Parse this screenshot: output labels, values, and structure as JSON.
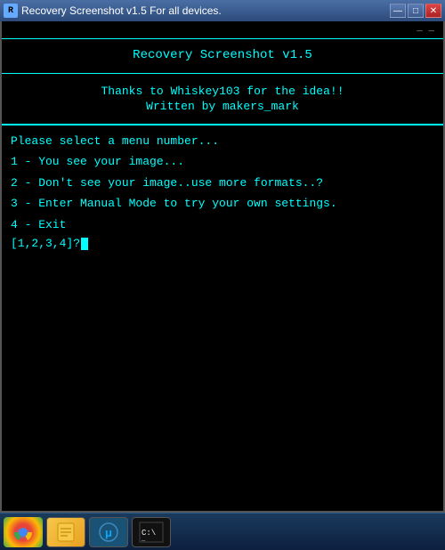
{
  "titlebar": {
    "icon_label": "R",
    "title": "Recovery Screenshot v1.5  For all devices.",
    "btn_minimize": "—",
    "btn_maximize": "□",
    "btn_close": "✕"
  },
  "terminal": {
    "top_dash": "_ _",
    "header_title": "Recovery Screenshot v1.5",
    "thanks_line1": "Thanks to Whiskey103 for the idea!!",
    "thanks_line2": "Written by makers_mark",
    "menu_prompt": "Please select a menu number...",
    "menu_items": [
      "1 - You see your image...",
      "2 - Don't see your image..use more formats..?",
      "3 - Enter Manual Mode to try your own settings.",
      "4 - Exit"
    ],
    "input_prompt": "[1,2,3,4]?"
  },
  "taskbar": {
    "chrome_label": "Chrome",
    "file_label": "Files",
    "torrent_label": "BitTorrent",
    "cmd_label": "CMD"
  }
}
